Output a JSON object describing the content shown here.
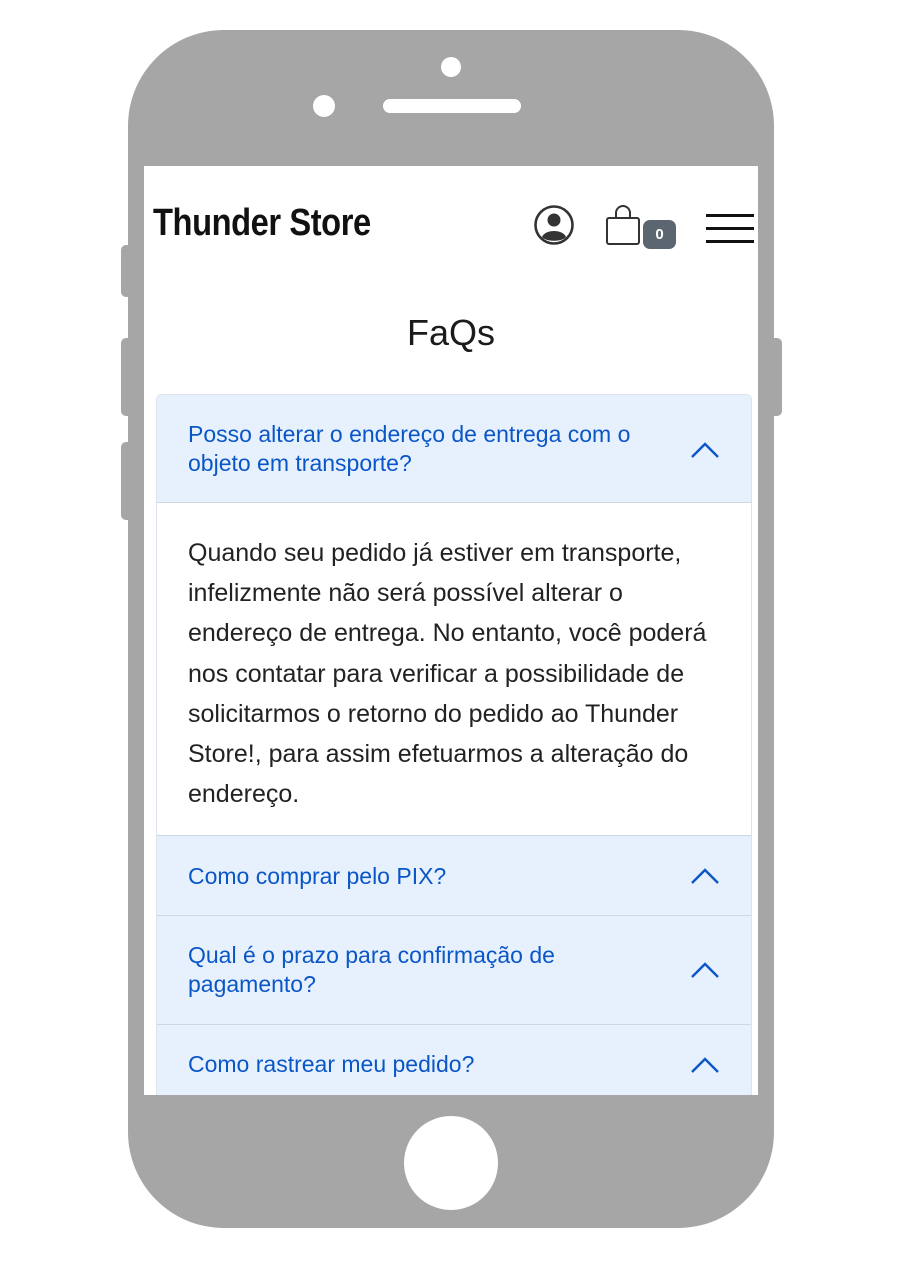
{
  "brand": "Thunder Store",
  "cart": {
    "count": "0"
  },
  "page_title": "FaQs",
  "faqs": [
    {
      "question": "Posso alterar o endereço de entrega com o objeto em transporte?",
      "answer": "Quando seu pedido já estiver em transporte, infelizmente não será possível alterar o endereço de entrega. No entanto, você poderá nos contatar para verificar a possibilidade de solicitarmos o retorno do pedido ao Thunder Store!, para assim efetuarmos a alteração do endereço.",
      "expanded": true
    },
    {
      "question": "Como comprar pelo PIX?",
      "expanded": false
    },
    {
      "question": "Qual é o prazo para confirmação de pagamento?",
      "expanded": false
    },
    {
      "question": "Como rastrear meu pedido?",
      "expanded": false
    }
  ],
  "icons": {
    "user": "user-circle-icon",
    "cart": "shopping-bag-icon",
    "menu": "hamburger-menu-icon",
    "chevron": "chevron-up-icon"
  },
  "colors": {
    "phone_frame": "#a6a6a6",
    "accordion_header_bg": "#e7f1fd",
    "accent": "#0b56c7",
    "badge_bg": "#5b6670"
  }
}
